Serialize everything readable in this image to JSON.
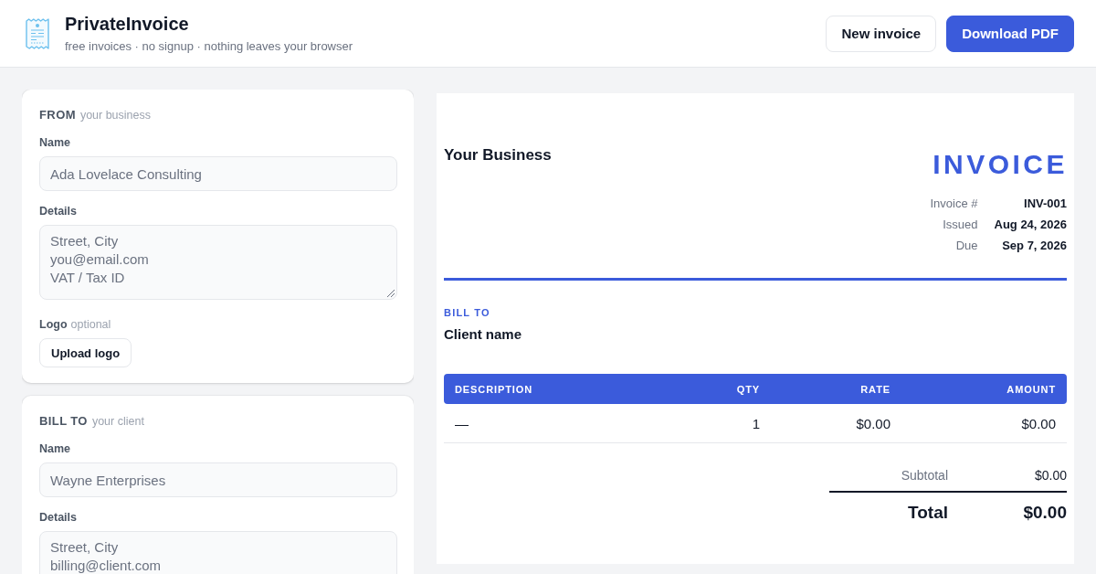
{
  "header": {
    "title": "PrivateInvoice",
    "tagline": "free invoices · no signup · nothing leaves your browser",
    "buttons": [
      {
        "label": "New invoice",
        "kind": "secondary"
      },
      {
        "label": "Download PDF",
        "kind": "primary"
      }
    ]
  },
  "editor": {
    "sections": [
      {
        "title": "FROM",
        "hint": "your business",
        "fields": [
          {
            "label": "Name",
            "kind": "input",
            "placeholder": "Ada Lovelace Consulting"
          },
          {
            "label": "Details",
            "kind": "textarea",
            "placeholder": "Street, City\nyou@email.com\nVAT / Tax ID",
            "grip": true
          },
          {
            "label": "Logo",
            "hint": "optional",
            "kind": "upload",
            "button": "Upload logo"
          }
        ]
      },
      {
        "title": "BILL TO",
        "hint": "your client",
        "fields": [
          {
            "label": "Name",
            "kind": "input",
            "placeholder": "Wayne Enterprises"
          },
          {
            "label": "Details",
            "kind": "textarea",
            "placeholder": "Street, City\nbilling@client.com",
            "grip": false
          }
        ]
      }
    ]
  },
  "preview": {
    "business_name": "Your Business",
    "doc_title": "INVOICE",
    "meta": [
      {
        "label": "Invoice #",
        "value": "INV-001"
      },
      {
        "label": "Issued",
        "value": "Aug 24, 2026"
      },
      {
        "label": "Due",
        "value": "Sep 7, 2026"
      }
    ],
    "bill_to_label": "BILL TO",
    "client_name": "Client name",
    "table": {
      "columns": [
        "DESCRIPTION",
        "QTY",
        "RATE",
        "AMOUNT"
      ],
      "rows": [
        [
          "—",
          "1",
          "$0.00",
          "$0.00"
        ]
      ]
    },
    "totals": [
      {
        "label": "Subtotal",
        "value": "$0.00",
        "kind": "subtotal"
      },
      {
        "label": "Total",
        "value": "$0.00",
        "kind": "total"
      }
    ]
  }
}
